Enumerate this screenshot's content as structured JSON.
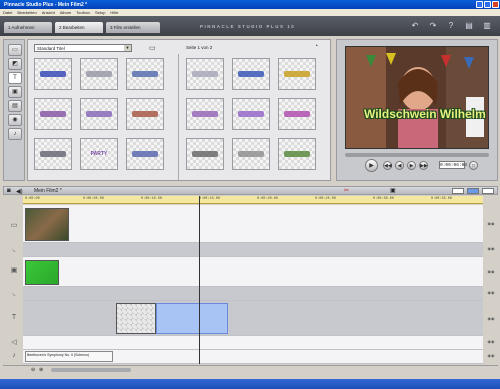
{
  "window": {
    "title": "Pinnacle Studio Plus - Mein Film2 *"
  },
  "menu": [
    "Datei",
    "Bearbeiten",
    "Ansicht",
    "Album",
    "Toolbox",
    "Setup",
    "Hilfe"
  ],
  "tabs": [
    {
      "label": "1  Aufnehmen"
    },
    {
      "label": "2  Bearbeiten"
    },
    {
      "label": "3  Film erstellen"
    }
  ],
  "brand": "PINNACLE STUDIO PLUS 10",
  "album": {
    "dropdown_value": "Standard Titel",
    "page_label": "Seite 1 von 2",
    "thumbs_left": [
      {
        "text": "",
        "color": "#3a4ab8"
      },
      {
        "text": "",
        "color": "#9a9aa8"
      },
      {
        "text": "",
        "color": "#5870b0"
      },
      {
        "text": "",
        "color": "#8a5aa8"
      },
      {
        "text": "",
        "color": "#8a6ab8"
      },
      {
        "text": "",
        "color": "#a85a48"
      },
      {
        "text": "",
        "color": "#6a6a78"
      },
      {
        "text": "PARTY",
        "color": "#7a4aa8"
      },
      {
        "text": "",
        "color": "#5a6ab0"
      }
    ],
    "thumbs_right": [
      {
        "text": "",
        "color": "#a8a8b8"
      },
      {
        "text": "",
        "color": "#3a58b8"
      },
      {
        "text": "",
        "color": "#c8a020"
      },
      {
        "text": "",
        "color": "#9868b8"
      },
      {
        "text": "",
        "color": "#9868c8"
      },
      {
        "text": "",
        "color": "#b050b0"
      },
      {
        "text": "",
        "color": "#6a6a6a"
      },
      {
        "text": "",
        "color": "#909090"
      },
      {
        "text": "",
        "color": "#5a8a40"
      }
    ]
  },
  "preview": {
    "overlay_text": "Wildschwein Wilhelm",
    "timecode": "0:00:06:04"
  },
  "timeline": {
    "title": "Mein Film2 *",
    "ruler": [
      "0:00:00",
      "0:00:05.00",
      "0:00:10.00",
      "0:00:15.00",
      "0:00:20.00",
      "0:00:25.00",
      "0:00:30.00",
      "0:00:35.00"
    ],
    "audio_clip_label": "Beethoven's Symphony No. 9 (Scherzo)"
  }
}
